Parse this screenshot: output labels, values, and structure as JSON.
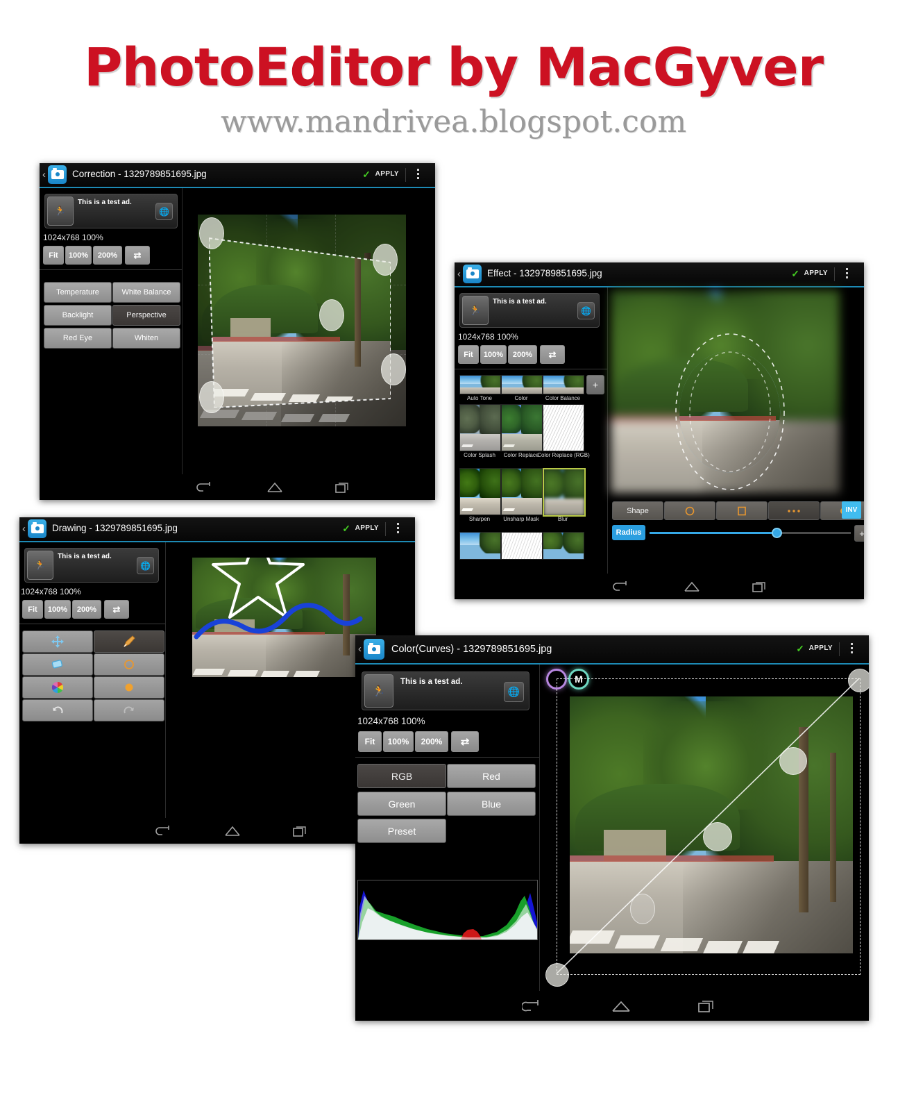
{
  "header": {
    "title": "PhotoEditor by MacGyver",
    "url": "www.mandrivea.blogspot.com"
  },
  "common": {
    "back_chevron": "‹",
    "apply_label": "APPLY",
    "check_glyph": "✓",
    "ad_text": "This is a test ad.",
    "ad_icon": "runner-icon",
    "ad_globe_icon": "globe-icon",
    "image_info": "1024x768 100%",
    "zoom_buttons": [
      "Fit",
      "100%",
      "200%"
    ],
    "swap_icon": "swap-arrows-icon",
    "nav": {
      "back": "back-icon",
      "home": "home-icon",
      "recents": "recents-icon"
    }
  },
  "panels": {
    "correction": {
      "title": "Correction - 1329789851695.jpg",
      "tools": [
        {
          "label": "Temperature",
          "selected": false
        },
        {
          "label": "White Balance",
          "selected": false
        },
        {
          "label": "Backlight",
          "selected": false
        },
        {
          "label": "Perspective",
          "selected": true
        },
        {
          "label": "Red Eye",
          "selected": false
        },
        {
          "label": "Whiten",
          "selected": false
        }
      ]
    },
    "effect": {
      "title": "Effect - 1329789851695.jpg",
      "add_label": "+",
      "effects": [
        {
          "label": "Auto Tone",
          "selected": false
        },
        {
          "label": "Color",
          "selected": false
        },
        {
          "label": "Color Balance",
          "selected": false
        },
        {
          "label": "Color Splash",
          "selected": false
        },
        {
          "label": "Color Replace",
          "selected": false
        },
        {
          "label": "Color Replace (RGB)",
          "selected": false
        },
        {
          "label": "Sharpen",
          "selected": false
        },
        {
          "label": "Unsharp Mask",
          "selected": false
        },
        {
          "label": "Blur",
          "selected": true
        }
      ],
      "shape_row": {
        "label": "Shape",
        "options": [
          "circle-outline-icon",
          "square-outline-icon",
          "dots-icon",
          "filled-dot-icon"
        ],
        "invert_label": "INV"
      },
      "slider": {
        "label": "Radius",
        "value_percent": 63,
        "plus_label": "+"
      }
    },
    "drawing": {
      "title": "Drawing - 1329789851695.jpg",
      "tools": [
        {
          "icon": "move-icon",
          "selected": false
        },
        {
          "icon": "brush-icon",
          "selected": true
        },
        {
          "icon": "eraser-icon",
          "selected": false
        },
        {
          "icon": "circle-outline-icon",
          "selected": false
        },
        {
          "icon": "color-wheel-icon",
          "selected": false
        },
        {
          "icon": "filled-dot-icon",
          "selected": false
        },
        {
          "icon": "undo-icon",
          "selected": false
        },
        {
          "icon": "redo-icon",
          "selected": false
        }
      ]
    },
    "curves": {
      "title": "Color(Curves) - 1329789851695.jpg",
      "channels": [
        {
          "label": "RGB",
          "selected": true
        },
        {
          "label": "Red",
          "selected": false
        },
        {
          "label": "Green",
          "selected": false
        },
        {
          "label": "Blue",
          "selected": false
        },
        {
          "label": "Preset",
          "selected": false
        }
      ],
      "markers": [
        {
          "label": "",
          "name": "curve-point-marker"
        },
        {
          "label": "M",
          "name": "curve-mode-marker"
        }
      ]
    }
  }
}
